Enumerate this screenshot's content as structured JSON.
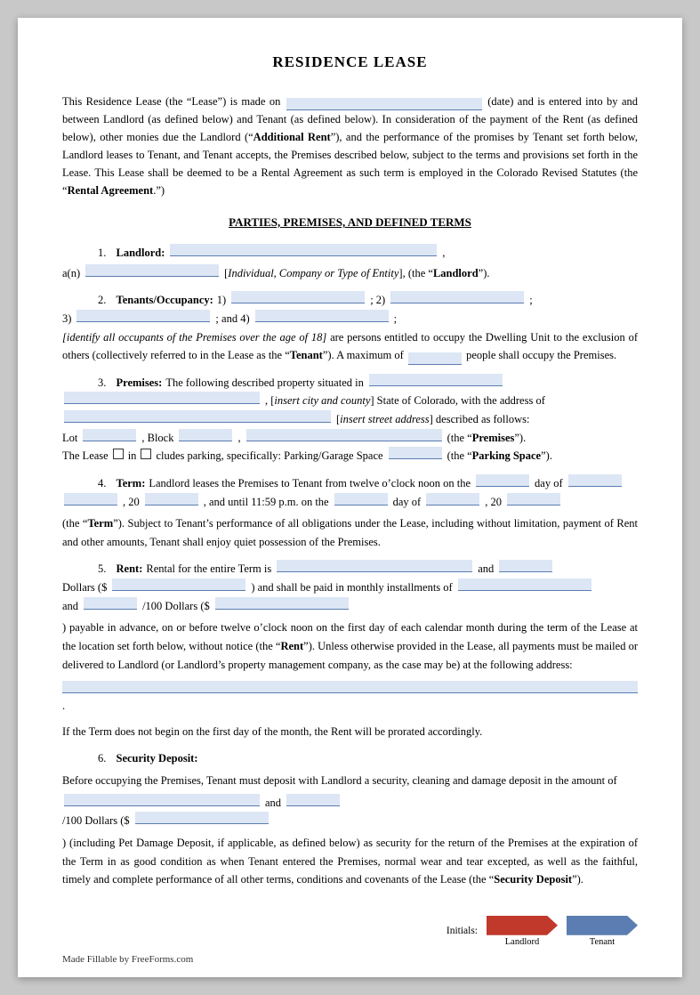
{
  "document": {
    "title": "RESIDENCE LEASE",
    "intro": {
      "text1": "This Residence Lease (the “Lease”) is made on",
      "text2": "(date) and is entered into by and between Landlord (as defined below) and Tenant (as defined below). In consideration of the payment of the Rent (as defined below), other monies due the Landlord (“",
      "additional_rent": "Additional Rent",
      "text3": "”), and the performance of the promises by Tenant set forth below, Landlord leases to Tenant, and Tenant accepts, the Premises described below, subject to the terms and provisions set forth in the Lease. This Lease shall be deemed to be a Rental Agreement as such term is employed in the Colorado Revised Statutes (the “",
      "rental_agreement": "Rental Agreement",
      "text4": "”.)"
    },
    "section_heading": "PARTIES, PREMISES, AND DEFINED TERMS",
    "sections": {
      "landlord": {
        "num": "1.",
        "label": "Landlord:",
        "text2": "a(n)",
        "text3": "[",
        "italic_text": "Individual, Company or Type of Entity",
        "text4": "], (the “",
        "bold_text": "Landlord",
        "text5": "”)."
      },
      "tenants": {
        "num": "2.",
        "label": "Tenants/Occupancy:",
        "text_1": "1)",
        "text_2": "; 2)",
        "text_3": "3)",
        "text_4": "; and 4)",
        "text_5": ";",
        "italic_note": "[identify all occupants of the Premises over the age of 18]",
        "text_6": " are persons entitled to occupy the Dwelling Unit to the exclusion of others (collectively referred to in the Lease as the “",
        "bold_tenant": "Tenant",
        "text_7": "”). A maximum of",
        "text_8": "people shall occupy the Premises."
      },
      "premises": {
        "num": "3.",
        "label": "Premises:",
        "text1": "The following described property situated in",
        "text2": ", [",
        "italic_text": "insert city and county",
        "text3": "] State of Colorado, with the address of",
        "italic_address": "insert street address",
        "text4": "] described as follows:",
        "lot_label": "Lot",
        "block_label": ", Block",
        "premises_label": "(the “Premises”).",
        "parking_text": "The Lease",
        "cludes_text": "cludes parking, specifically: Parking/Garage Space",
        "parking_space_label": "(the “",
        "bold_parking": "Parking Space",
        "parking_end": "”)."
      },
      "term": {
        "num": "4.",
        "label": "Term:",
        "text1": "Landlord leases the Premises to Tenant from twelve o’clock noon on the",
        "text2": "day of",
        "text3": ", 20",
        "text4": ", and until 11:59 p.m. on the",
        "text5": "day of",
        "text6": ", 20",
        "text7": "(the “",
        "bold_term": "Term",
        "text8": "”). Subject to Tenant’s performance of all obligations under the Lease, including without limitation, payment of Rent and other amounts, Tenant shall enjoy quiet possession of the Premises."
      },
      "rent": {
        "num": "5.",
        "label": "Rent:",
        "text1": "Rental for the entire Term is",
        "text2": "and",
        "text3": "/100 Dollars ($",
        "text4": ") and shall be paid in monthly installments of",
        "text5": "and",
        "text6": "/100 Dollars ($",
        "text7": ") payable in advance, on or before twelve o’clock noon on the first day of each calendar month during the term of the Lease at the location set forth below, without notice (the “",
        "bold_rent": "Rent",
        "text8": "”). Unless otherwise provided in the Lease, all payments must be mailed or delivered to Landlord (or Landlord’s property management company, as the case may be) at the following address:",
        "prorate_text": "If the Term does not begin on the first day of the month, the Rent will be prorated accordingly."
      },
      "security": {
        "num": "6.",
        "label": "Security Deposit:",
        "text1": "Before occupying the Premises, Tenant must deposit with Landlord a security, cleaning and damage deposit in the amount of",
        "text2": "and",
        "text3": "/100 Dollars ($",
        "text4": ") (including Pet Damage Deposit, if applicable, as defined below) as security for the return of the Premises at the expiration of the Term in as good condition as when Tenant entered the Premises, normal wear and tear excepted, as well as the faithful, timely and complete performance of all other terms, conditions and covenants of the Lease (the “",
        "bold_sd": "Security Deposit",
        "text5": "”)."
      }
    },
    "footer": {
      "initials_label": "Initials:",
      "landlord_label": "Landlord",
      "tenant_label": "Tenant"
    },
    "made_by": "Made Fillable by FreeForms.com"
  }
}
